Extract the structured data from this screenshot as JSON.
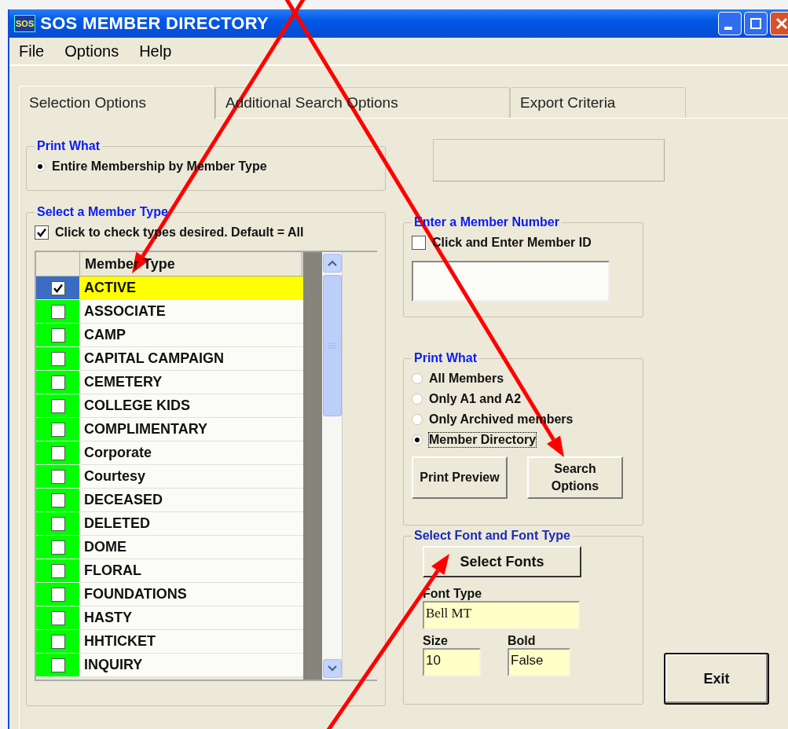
{
  "window": {
    "title": "SOS MEMBER DIRECTORY",
    "app_icon": "SOS"
  },
  "menu": [
    "File",
    "Options",
    "Help"
  ],
  "tabs": [
    {
      "label": "Selection Options",
      "selected": true
    },
    {
      "label": "Additional Search Options",
      "selected": false
    },
    {
      "label": "Export Criteria",
      "selected": false
    }
  ],
  "print_what_top": {
    "title": "Print What",
    "options": [
      {
        "label": "Entire Membership by Member Type",
        "selected": true
      }
    ]
  },
  "member_type": {
    "title": "Select a Member Type",
    "check_all": {
      "label": "Click to check types desired. Default = All",
      "checked": true
    },
    "table": {
      "columns": [
        "Member Type"
      ],
      "rows": [
        {
          "label": "ACTIVE",
          "checked": true,
          "selected": true
        },
        {
          "label": "ASSOCIATE",
          "checked": false,
          "selected": false
        },
        {
          "label": "CAMP",
          "checked": false,
          "selected": false
        },
        {
          "label": "CAPITAL CAMPAIGN",
          "checked": false,
          "selected": false
        },
        {
          "label": "CEMETERY",
          "checked": false,
          "selected": false
        },
        {
          "label": "COLLEGE KIDS",
          "checked": false,
          "selected": false
        },
        {
          "label": "COMPLIMENTARY",
          "checked": false,
          "selected": false
        },
        {
          "label": "Corporate",
          "checked": false,
          "selected": false
        },
        {
          "label": "Courtesy",
          "checked": false,
          "selected": false
        },
        {
          "label": "DECEASED",
          "checked": false,
          "selected": false
        },
        {
          "label": "DELETED",
          "checked": false,
          "selected": false
        },
        {
          "label": "DOME",
          "checked": false,
          "selected": false
        },
        {
          "label": "FLORAL",
          "checked": false,
          "selected": false
        },
        {
          "label": "FOUNDATIONS",
          "checked": false,
          "selected": false
        },
        {
          "label": "HASTY",
          "checked": false,
          "selected": false
        },
        {
          "label": "HHTICKET",
          "checked": false,
          "selected": false
        },
        {
          "label": "INQUIRY",
          "checked": false,
          "selected": false
        }
      ]
    }
  },
  "member_number": {
    "title": "Enter a Member Number",
    "checkbox": {
      "label": "Click and Enter Member ID",
      "checked": false
    }
  },
  "print_what": {
    "title": "Print What",
    "options": [
      {
        "label": "All Members",
        "selected": false,
        "focused": false
      },
      {
        "label": "Only A1 and A2",
        "selected": false,
        "focused": false
      },
      {
        "label": "Only Archived members",
        "selected": false,
        "focused": false
      },
      {
        "label": "Member Directory",
        "selected": true,
        "focused": true
      }
    ],
    "buttons": [
      "Print Preview",
      "Search Options"
    ]
  },
  "font": {
    "title": "Select Font and Font Type",
    "button": "Select Fonts",
    "fields": [
      {
        "label": "Font Type",
        "value": "Bell MT"
      },
      {
        "label": "Size",
        "value": "10"
      },
      {
        "label": "Bold",
        "value": "False"
      }
    ]
  },
  "exit_button": "Exit"
}
